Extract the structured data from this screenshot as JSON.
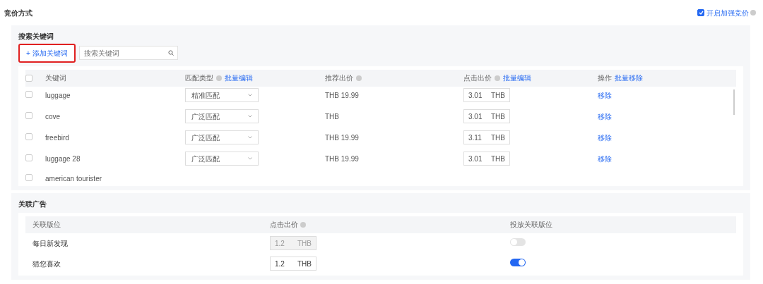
{
  "title": "竞价方式",
  "enhanced_bidding": {
    "label": "开启加强竞价",
    "checked": true
  },
  "keywords": {
    "label": "搜索关键词",
    "add_button": "+ 添加关键词",
    "all_checked": false,
    "search": {
      "placeholder": "搜索关键词"
    },
    "columns": [
      {
        "label": "关键词"
      },
      {
        "label": "匹配类型",
        "help": true,
        "action": "批量编辑"
      },
      {
        "label": "推荐出价",
        "help": true
      },
      {
        "label": "点击出价",
        "help": true,
        "action": "批量编辑"
      },
      {
        "label": "操作",
        "action": "批量移除"
      }
    ],
    "rows": [
      {
        "checked": false,
        "keyword": "luggage",
        "match": "精准匹配",
        "suggested": "THB 19.99",
        "bid": "3.01",
        "currency": "THB",
        "action": "移除"
      },
      {
        "checked": false,
        "keyword": "cove",
        "match": "广泛匹配",
        "suggested": "THB",
        "bid": "3.01",
        "currency": "THB",
        "action": "移除"
      },
      {
        "checked": false,
        "keyword": "freebird",
        "match": "广泛匹配",
        "suggested": "THB 19.99",
        "bid": "3.11",
        "currency": "THB",
        "action": "移除"
      },
      {
        "checked": false,
        "keyword": "luggage 28",
        "match": "广泛匹配",
        "suggested": "THB 19.99",
        "bid": "3.01",
        "currency": "THB",
        "action": "移除"
      },
      {
        "checked": false,
        "keyword": "american tourister"
      }
    ]
  },
  "related_ads": {
    "label": "关联广告",
    "columns": [
      "关联版位",
      "点击出价",
      "投放关联版位"
    ],
    "rows": [
      {
        "placement": "每日新发现",
        "bid": "1.2",
        "currency": "THB",
        "disabled": true,
        "on": false
      },
      {
        "placement": "猜您喜欢",
        "bid": "1.2",
        "currency": "THB",
        "disabled": false,
        "on": true
      }
    ]
  }
}
